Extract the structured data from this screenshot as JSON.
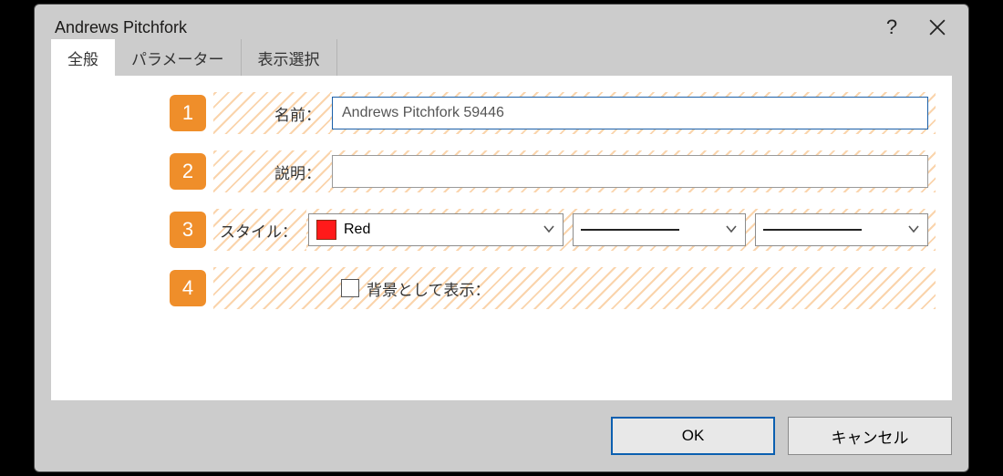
{
  "dialog": {
    "title": "Andrews Pitchfork"
  },
  "tabs": [
    {
      "label": "全般"
    },
    {
      "label": "パラメーター"
    },
    {
      "label": "表示選択"
    }
  ],
  "rows": {
    "name": {
      "num": "1",
      "label": "名前：",
      "value": "Andrews Pitchfork 59446"
    },
    "desc": {
      "num": "2",
      "label": "説明：",
      "value": ""
    },
    "style": {
      "num": "3",
      "label": "スタイル：",
      "color_name": "Red",
      "color_hex": "#ff1a1a"
    },
    "background": {
      "num": "4",
      "checkbox_label": "背景として表示："
    }
  },
  "buttons": {
    "ok": "OK",
    "cancel": "キャンセル"
  }
}
